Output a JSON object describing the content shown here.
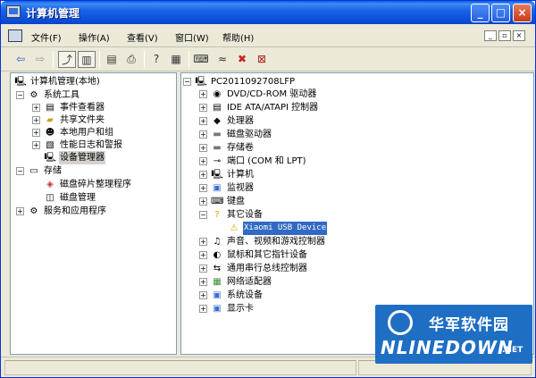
{
  "window": {
    "title": "计算机管理"
  },
  "menu": {
    "items": [
      "文件(F)",
      "操作(A)",
      "查看(V)",
      "窗口(W)",
      "帮助(H)"
    ],
    "mdi": [
      "_",
      "▫",
      "×"
    ]
  },
  "left_tree": {
    "root": "计算机管理(本地)",
    "items": [
      {
        "label": "系统工具"
      },
      {
        "label": "事件查看器"
      },
      {
        "label": "共享文件夹"
      },
      {
        "label": "本地用户和组"
      },
      {
        "label": "性能日志和警报"
      },
      {
        "label": "设备管理器"
      },
      {
        "label": "存储"
      },
      {
        "label": "磁盘碎片整理程序"
      },
      {
        "label": "磁盘管理"
      },
      {
        "label": "服务和应用程序"
      }
    ]
  },
  "right_tree": {
    "root": "PC2011092708LFP",
    "items": [
      {
        "label": "DVD/CD-ROM 驱动器"
      },
      {
        "label": "IDE ATA/ATAPI 控制器"
      },
      {
        "label": "处理器"
      },
      {
        "label": "磁盘驱动器"
      },
      {
        "label": "存储卷"
      },
      {
        "label": "端口 (COM 和 LPT)"
      },
      {
        "label": "计算机"
      },
      {
        "label": "监视器"
      },
      {
        "label": "键盘"
      },
      {
        "label": "其它设备"
      },
      {
        "label": "Xiaomi USB Device"
      },
      {
        "label": "声音、视频和游戏控制器"
      },
      {
        "label": "鼠标和其它指针设备"
      },
      {
        "label": "通用串行总线控制器"
      },
      {
        "label": "网络适配器"
      },
      {
        "label": "系统设备"
      },
      {
        "label": "显示卡"
      }
    ]
  },
  "watermark": {
    "cn": "华军软件园",
    "en": "NLINEDOWN",
    "net": ".NET"
  }
}
